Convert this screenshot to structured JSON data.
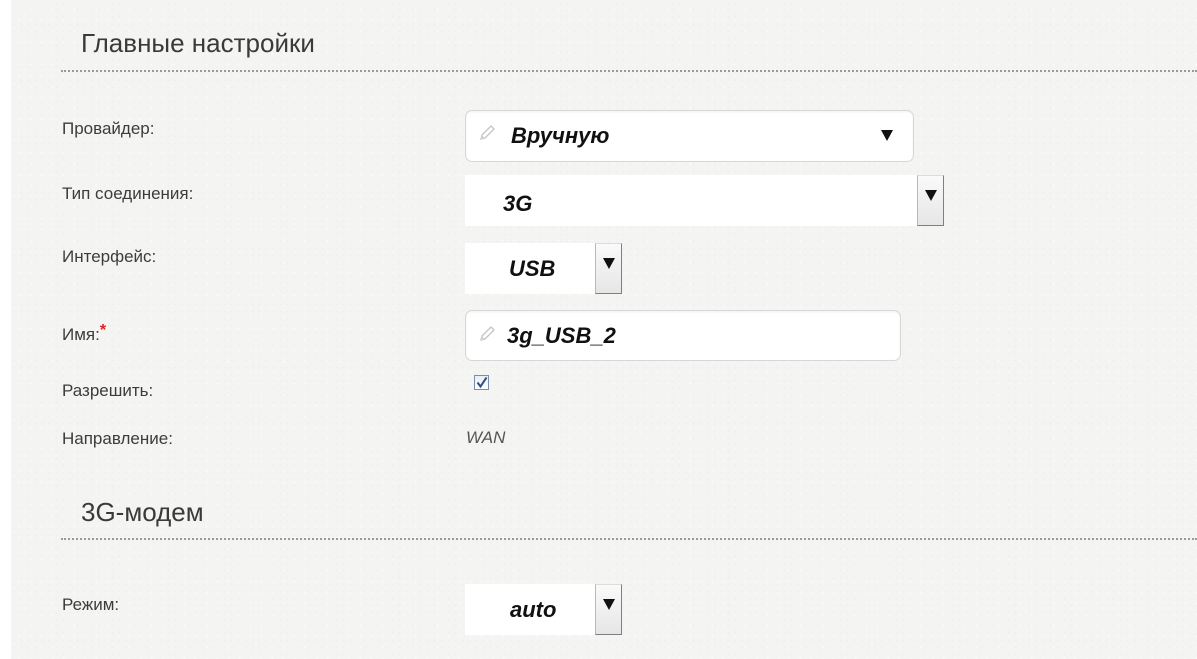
{
  "sections": {
    "main": {
      "title": "Главные настройки"
    },
    "modem": {
      "title": "3G-модем"
    }
  },
  "fields": {
    "provider": {
      "label": "Провайдер:",
      "value": "Вручную"
    },
    "connection_type": {
      "label": "Тип соединения:",
      "value": "3G"
    },
    "interface": {
      "label": "Интерфейс:",
      "value": "USB"
    },
    "name": {
      "label": "Имя:",
      "required_mark": "*",
      "value": "3g_USB_2"
    },
    "enable": {
      "label": "Разрешить:",
      "checked": true
    },
    "direction": {
      "label": "Направление:",
      "value": "WAN"
    },
    "mode": {
      "label": "Режим:",
      "value": "auto"
    }
  },
  "icons": {
    "edit": "pencil-icon",
    "dropdown": "triangle-down-icon",
    "check": "checkmark-icon"
  },
  "colors": {
    "background": "#f4f4f3",
    "text": "#3c3c3c",
    "required": "#e02020",
    "value_text": "#111111"
  }
}
